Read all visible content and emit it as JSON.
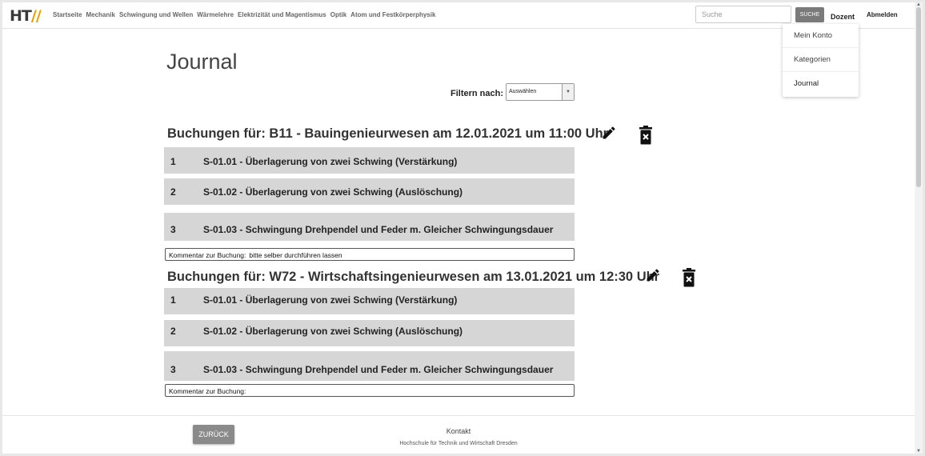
{
  "nav": {
    "logo": "HTW",
    "menu": [
      "Startseite",
      "Mechanik",
      "Schwingung und Wellen",
      "Wärmelehre",
      "Elektrizität und Magentismus",
      "Optik",
      "Atom und Festkörperphysik"
    ],
    "search_placeholder": "Suche",
    "search_button": "SUCHE",
    "user_role": "Dozent",
    "logout": "Abmelden"
  },
  "dropdown": {
    "items": [
      "Mein Konto",
      "Kategorien",
      "Journal"
    ]
  },
  "page": {
    "title": "Journal",
    "filter_label": "Filtern nach:",
    "filter_value": "Auswählen"
  },
  "bookings": [
    {
      "heading": "Buchungen für: B11 - Bauingenieurwesen am 12.01.2021 um 11:00 Uhr",
      "items": [
        {
          "num": "1",
          "text": "S-01.01 - Überlagerung von zwei Schwing (Verstärkung)"
        },
        {
          "num": "2",
          "text": "S-01.02 - Überlagerung von zwei Schwing (Auslöschung)"
        },
        {
          "num": "3",
          "text": "S-01.03 - Schwingung Drehpendel und Feder m. Gleicher Schwingungsdauer"
        }
      ],
      "comment_label": "Kommentar zur Buchung:",
      "comment_value": "bitte selber durchführen lassen"
    },
    {
      "heading": "Buchungen für: W72 - Wirtschaftsingenieurwesen am 13.01.2021 um 12:30 Uhr",
      "items": [
        {
          "num": "1",
          "text": "S-01.01 - Überlagerung von zwei Schwing (Verstärkung)"
        },
        {
          "num": "2",
          "text": "S-01.02 - Überlagerung von zwei Schwing (Auslöschung)"
        },
        {
          "num": "3",
          "text": "S-01.03 - Schwingung Drehpendel und Feder m. Gleicher Schwingungsdauer"
        }
      ],
      "comment_label": "Kommentar zur Buchung:",
      "comment_value": ""
    }
  ],
  "footer": {
    "back_button": "ZURÜCK",
    "contact": "Kontakt",
    "org": "Hochschule für Technik und Wirtschaft Dresden"
  },
  "icons": {
    "edit": "pencil-icon",
    "delete": "trash-x-icon"
  }
}
